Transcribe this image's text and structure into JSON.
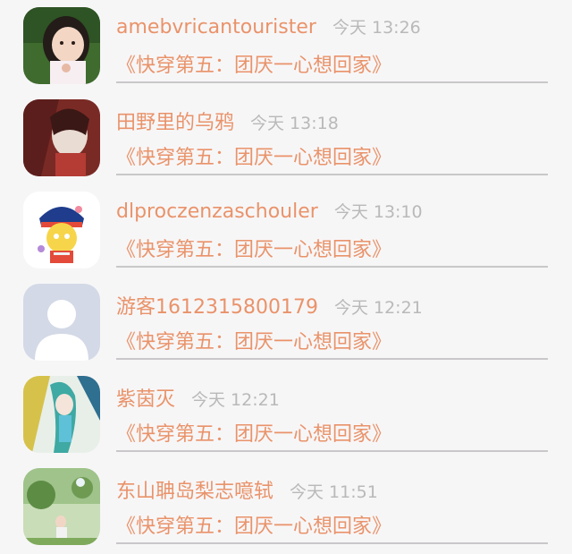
{
  "comments": [
    {
      "name": "amebvricantourister",
      "time": "今天 13:26",
      "book": "《快穿第五：团厌一心想回家》"
    },
    {
      "name": "田野里的乌鸦",
      "time": "今天 13:18",
      "book": "《快穿第五：团厌一心想回家》"
    },
    {
      "name": "dlproczenzaschouler",
      "time": "今天 13:10",
      "book": "《快穿第五：团厌一心想回家》"
    },
    {
      "name": "游客1612315800179",
      "time": "今天 12:21",
      "book": "《快穿第五：团厌一心想回家》"
    },
    {
      "name": "紫茵灭",
      "time": "今天 12:21",
      "book": "《快穿第五：团厌一心想回家》"
    },
    {
      "name": "东山聃岛梨志噫轼",
      "time": "今天 11:51",
      "book": "《快穿第五：团厌一心想回家》"
    }
  ]
}
